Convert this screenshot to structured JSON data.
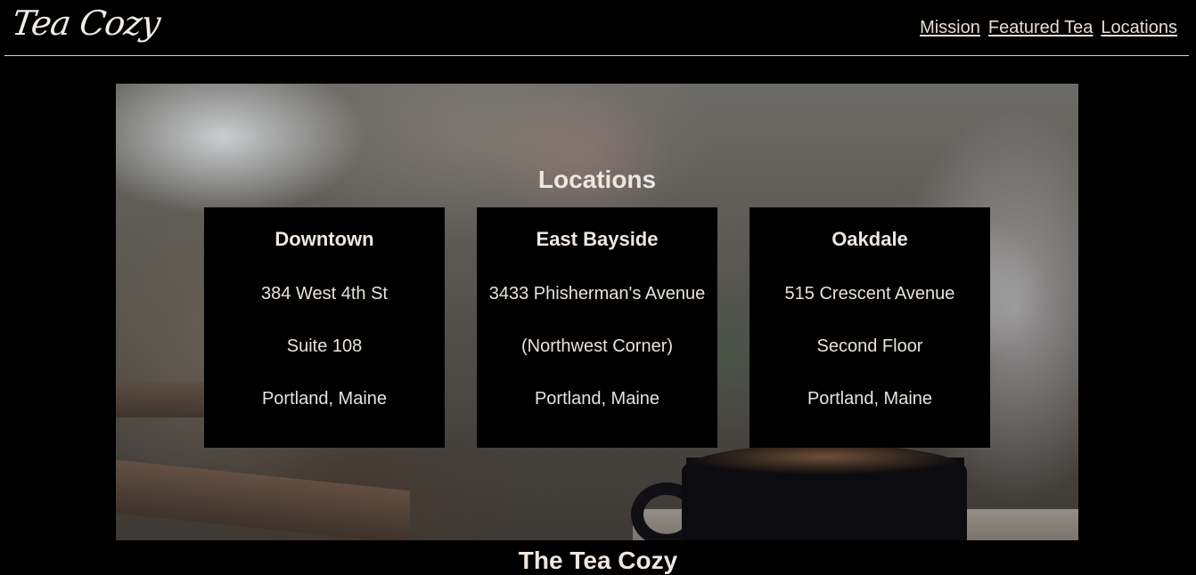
{
  "header": {
    "logo": "Tea Cozy",
    "nav": [
      "Mission",
      "Featured Tea",
      "Locations"
    ]
  },
  "locations": {
    "title": "Locations",
    "cards": [
      {
        "name": "Downtown",
        "line1": "384 West 4th St",
        "line2": "Suite 108",
        "line3": "Portland, Maine"
      },
      {
        "name": "East Bayside",
        "line1": "3433 Phisherman's Avenue",
        "line2": "(Northwest Corner)",
        "line3": "Portland, Maine"
      },
      {
        "name": "Oakdale",
        "line1": "515 Crescent Avenue",
        "line2": "Second Floor",
        "line3": "Portland, Maine"
      }
    ]
  },
  "footer": {
    "title": "The Tea Cozy"
  }
}
